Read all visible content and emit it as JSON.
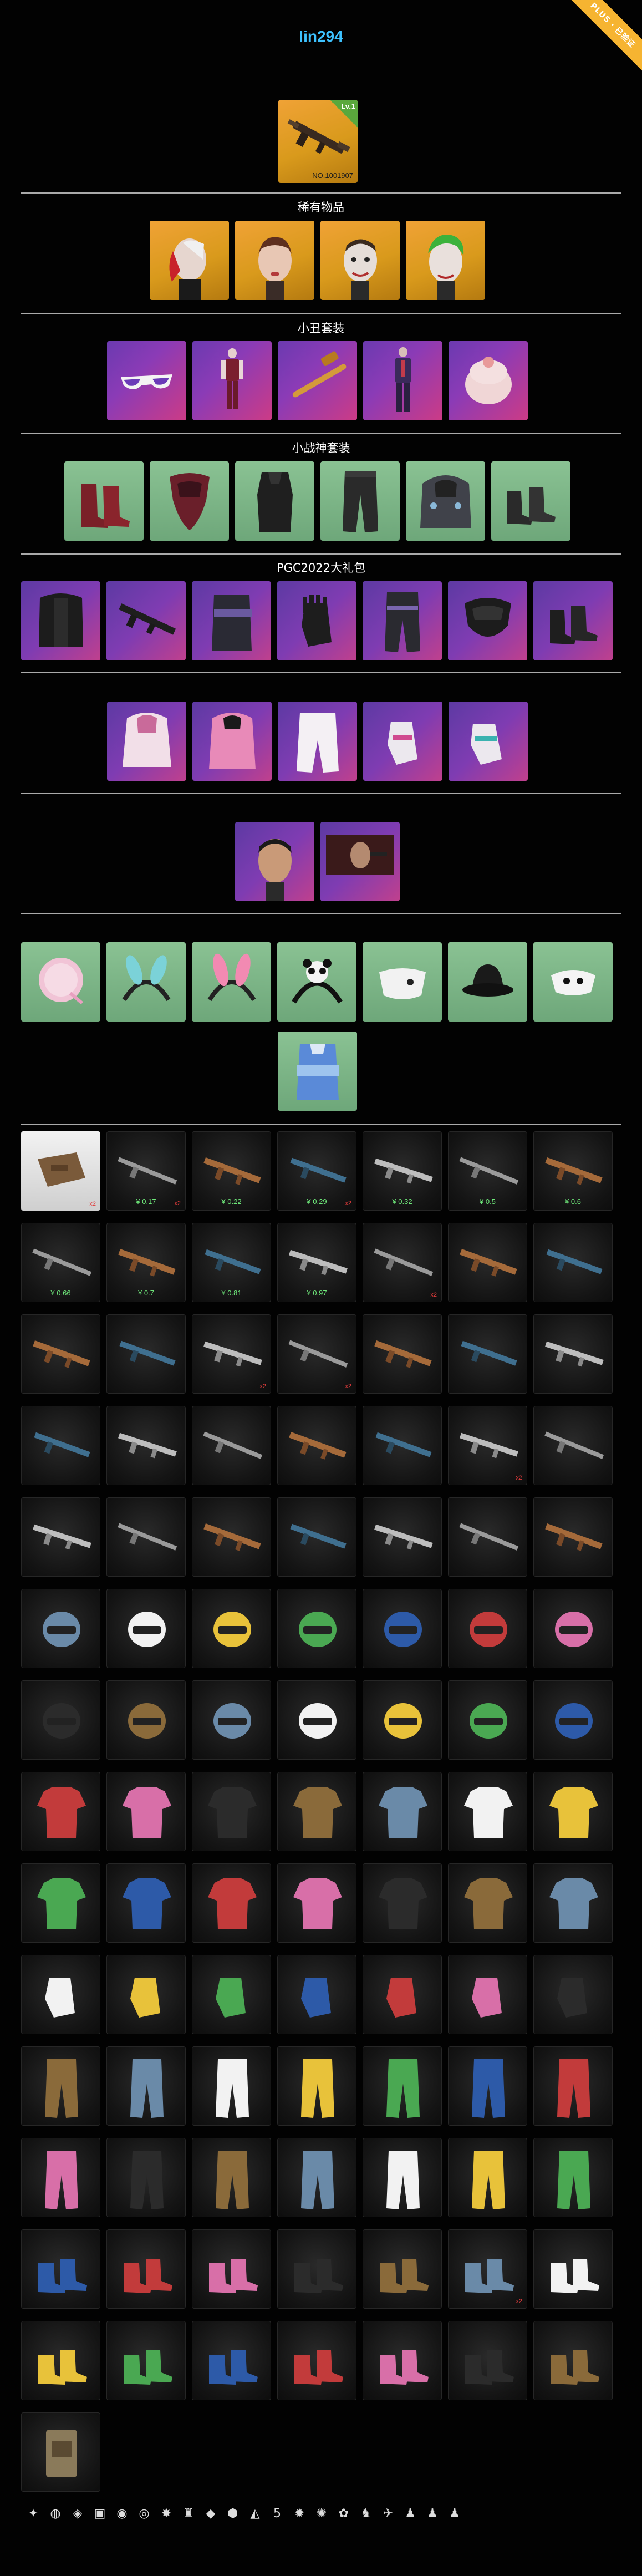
{
  "header": {
    "username": "lin294",
    "badge": "PLUS · 已验证"
  },
  "featured": {
    "level": "Lv.1",
    "number": "NO.1001907",
    "icon": "m416-rifle-icon"
  },
  "sections": [
    {
      "title": "稀有物品"
    },
    {
      "title": "小丑套装"
    },
    {
      "title": "小战神套装"
    },
    {
      "title": "PGC2022大礼包"
    }
  ],
  "weapons": [
    {
      "price": "",
      "qty": "x2",
      "icon": "crate-icon"
    },
    {
      "price": "¥ 0.17",
      "qty": "x2",
      "icon": "rifle-icon"
    },
    {
      "price": "¥ 0.22",
      "qty": "",
      "icon": "shotgun-icon"
    },
    {
      "price": "¥ 0.29",
      "qty": "x2",
      "icon": "smg-icon"
    },
    {
      "price": "¥ 0.32",
      "qty": "",
      "icon": "pistol-icon"
    },
    {
      "price": "¥ 0.5",
      "qty": "",
      "icon": "rifle-icon"
    },
    {
      "price": "¥ 0.6",
      "qty": "",
      "icon": "rifle-icon"
    },
    {
      "price": "¥ 0.66",
      "qty": "",
      "icon": "rifle-icon"
    },
    {
      "price": "¥ 0.7",
      "qty": "",
      "icon": "rifle-icon"
    },
    {
      "price": "¥ 0.81",
      "qty": "",
      "icon": "rifle-icon"
    },
    {
      "price": "¥ 0.97",
      "qty": "",
      "icon": "rifle-icon"
    },
    {
      "price": "",
      "qty": "x2",
      "icon": "rifle-icon"
    },
    {
      "price": "",
      "qty": "",
      "icon": "rifle-icon"
    },
    {
      "price": "",
      "qty": "",
      "icon": "rifle-icon"
    }
  ],
  "qty_marks": {
    "r3c2": "x2",
    "r3c3": "x2",
    "r4c5": "x2",
    "r13c5": "x2"
  },
  "achievements": [
    "✦",
    "◍",
    "◈",
    "▣",
    "◉",
    "◎",
    "✸",
    "♜",
    "◆",
    "⬢",
    "◭",
    "5",
    "✹",
    "✺",
    "✿",
    "♞",
    "✈",
    "♟",
    "♟",
    "♟"
  ]
}
